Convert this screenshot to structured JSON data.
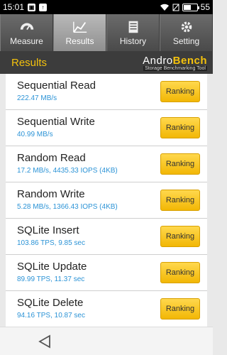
{
  "status": {
    "time": "15:01",
    "battery": "55",
    "battery_level": 0.55
  },
  "tabs": [
    {
      "label": "Measure",
      "icon": "measure-icon"
    },
    {
      "label": "Results",
      "icon": "chart-icon",
      "active": true
    },
    {
      "label": "History",
      "icon": "history-icon"
    },
    {
      "label": "Setting",
      "icon": "gear-icon"
    }
  ],
  "header": {
    "title": "Results",
    "logo_andro": "Andro",
    "logo_bench": "Bench",
    "logo_sub": "Storage Benchmarking Tool"
  },
  "results": [
    {
      "name": "Sequential Read",
      "value": "222.47 MB/s",
      "button": "Ranking"
    },
    {
      "name": "Sequential Write",
      "value": "40.99 MB/s",
      "button": "Ranking"
    },
    {
      "name": "Random Read",
      "value": "17.2 MB/s, 4435.33 IOPS (4KB)",
      "button": "Ranking"
    },
    {
      "name": "Random Write",
      "value": "5.28 MB/s, 1366.43 IOPS (4KB)",
      "button": "Ranking"
    },
    {
      "name": "SQLite Insert",
      "value": "103.86 TPS, 9.85 sec",
      "button": "Ranking"
    },
    {
      "name": "SQLite Update",
      "value": "89.99 TPS, 11.37 sec",
      "button": "Ranking"
    },
    {
      "name": "SQLite Delete",
      "value": "94.16 TPS, 10.87 sec",
      "button": "Ranking"
    }
  ],
  "colors": {
    "accent": "#f4c20d",
    "value_text": "#2b93d6",
    "button": "#f2b705"
  }
}
